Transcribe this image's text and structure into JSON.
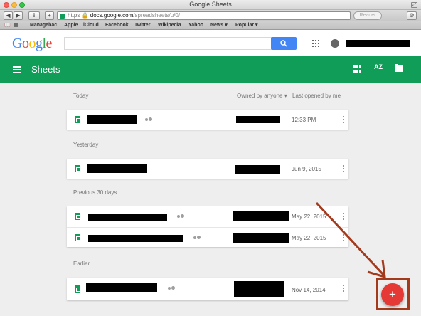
{
  "window": {
    "title": "Google Sheets"
  },
  "toolbar": {
    "back_label": "◀",
    "forward_label": "▶",
    "share_label": "⇪",
    "add_label": "+",
    "url_scheme": "https",
    "url_domain": "docs.google.com",
    "url_path": "/spreadsheets/u/0/",
    "reader_label": "Reader",
    "gear_label": "⚙"
  },
  "bookmarks": {
    "items": [
      "Managebac",
      "Apple",
      "iCloud",
      "Facebook",
      "Twitter",
      "Wikipedia",
      "Yahoo",
      "News ▾",
      "Popular ▾"
    ]
  },
  "header": {
    "logo_letters": [
      "G",
      "o",
      "o",
      "g",
      "l",
      "e"
    ]
  },
  "appbar": {
    "title": "Sheets",
    "sort_label": "AZ"
  },
  "list": {
    "owner_filter": "Owned by anyone",
    "sort_label": "Last opened by me",
    "sections": [
      {
        "label": "Today",
        "rows": [
          {
            "date": "12:33 PM"
          }
        ]
      },
      {
        "label": "Yesterday",
        "rows": [
          {
            "date": "Jun 9, 2015"
          }
        ]
      },
      {
        "label": "Previous 30 days",
        "rows": [
          {
            "date": "May 22, 2015"
          },
          {
            "date": "May 22, 2015"
          }
        ]
      },
      {
        "label": "Earlier",
        "rows": [
          {
            "date": "Nov 14, 2014"
          }
        ]
      }
    ]
  },
  "fab": {
    "label": "+"
  },
  "colors": {
    "sheets_green": "#0f9d58",
    "fab_red": "#e53935",
    "annotation": "#a33a1c"
  }
}
